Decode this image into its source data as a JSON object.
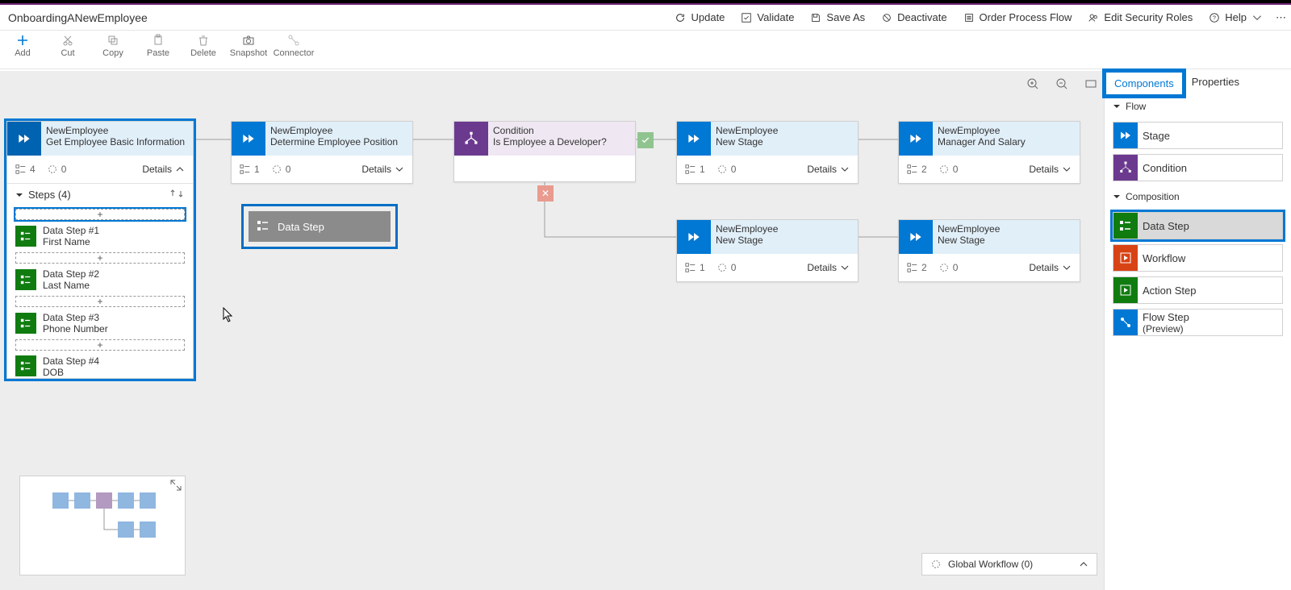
{
  "title": "OnboardingANewEmployee",
  "commands": {
    "update": "Update",
    "validate": "Validate",
    "saveas": "Save As",
    "deactivate": "Deactivate",
    "order": "Order Process Flow",
    "security": "Edit Security Roles",
    "help": "Help"
  },
  "toolbar": {
    "add": "Add",
    "cut": "Cut",
    "copy": "Copy",
    "paste": "Paste",
    "delete": "Delete",
    "snapshot": "Snapshot",
    "connector": "Connector"
  },
  "stages": {
    "s1": {
      "entity": "NewEmployee",
      "name": "Get Employee Basic Information",
      "stepCount": "4",
      "trigCount": "0",
      "details": "Details",
      "stepsHdr": "Steps (4)",
      "steps": [
        {
          "t1": "Data Step #1",
          "t2": "First Name"
        },
        {
          "t1": "Data Step #2",
          "t2": "Last Name"
        },
        {
          "t1": "Data Step #3",
          "t2": "Phone Number"
        },
        {
          "t1": "Data Step #4",
          "t2": "DOB"
        }
      ]
    },
    "s2": {
      "entity": "NewEmployee",
      "name": "Determine Employee Position",
      "stepCount": "1",
      "trigCount": "0",
      "details": "Details"
    },
    "s3": {
      "entity": "Condition",
      "name": "Is Employee a Developer?"
    },
    "s4": {
      "entity": "NewEmployee",
      "name": "New Stage",
      "stepCount": "1",
      "trigCount": "0",
      "details": "Details"
    },
    "s5": {
      "entity": "NewEmployee",
      "name": "Manager And Salary",
      "stepCount": "2",
      "trigCount": "0",
      "details": "Details"
    },
    "s6": {
      "entity": "NewEmployee",
      "name": "New Stage",
      "stepCount": "1",
      "trigCount": "0",
      "details": "Details"
    },
    "s7": {
      "entity": "NewEmployee",
      "name": "New Stage",
      "stepCount": "2",
      "trigCount": "0",
      "details": "Details"
    }
  },
  "drag": {
    "label": "Data Step"
  },
  "globalWorkflow": "Global Workflow (0)",
  "side": {
    "tabs": {
      "components": "Components",
      "properties": "Properties"
    },
    "flowHdr": "Flow",
    "compHdr": "Composition",
    "items": {
      "stage": "Stage",
      "condition": "Condition",
      "datastep": "Data Step",
      "workflow": "Workflow",
      "actionstep": "Action Step",
      "flowstep1": "Flow Step",
      "flowstep2": "(Preview)"
    }
  }
}
